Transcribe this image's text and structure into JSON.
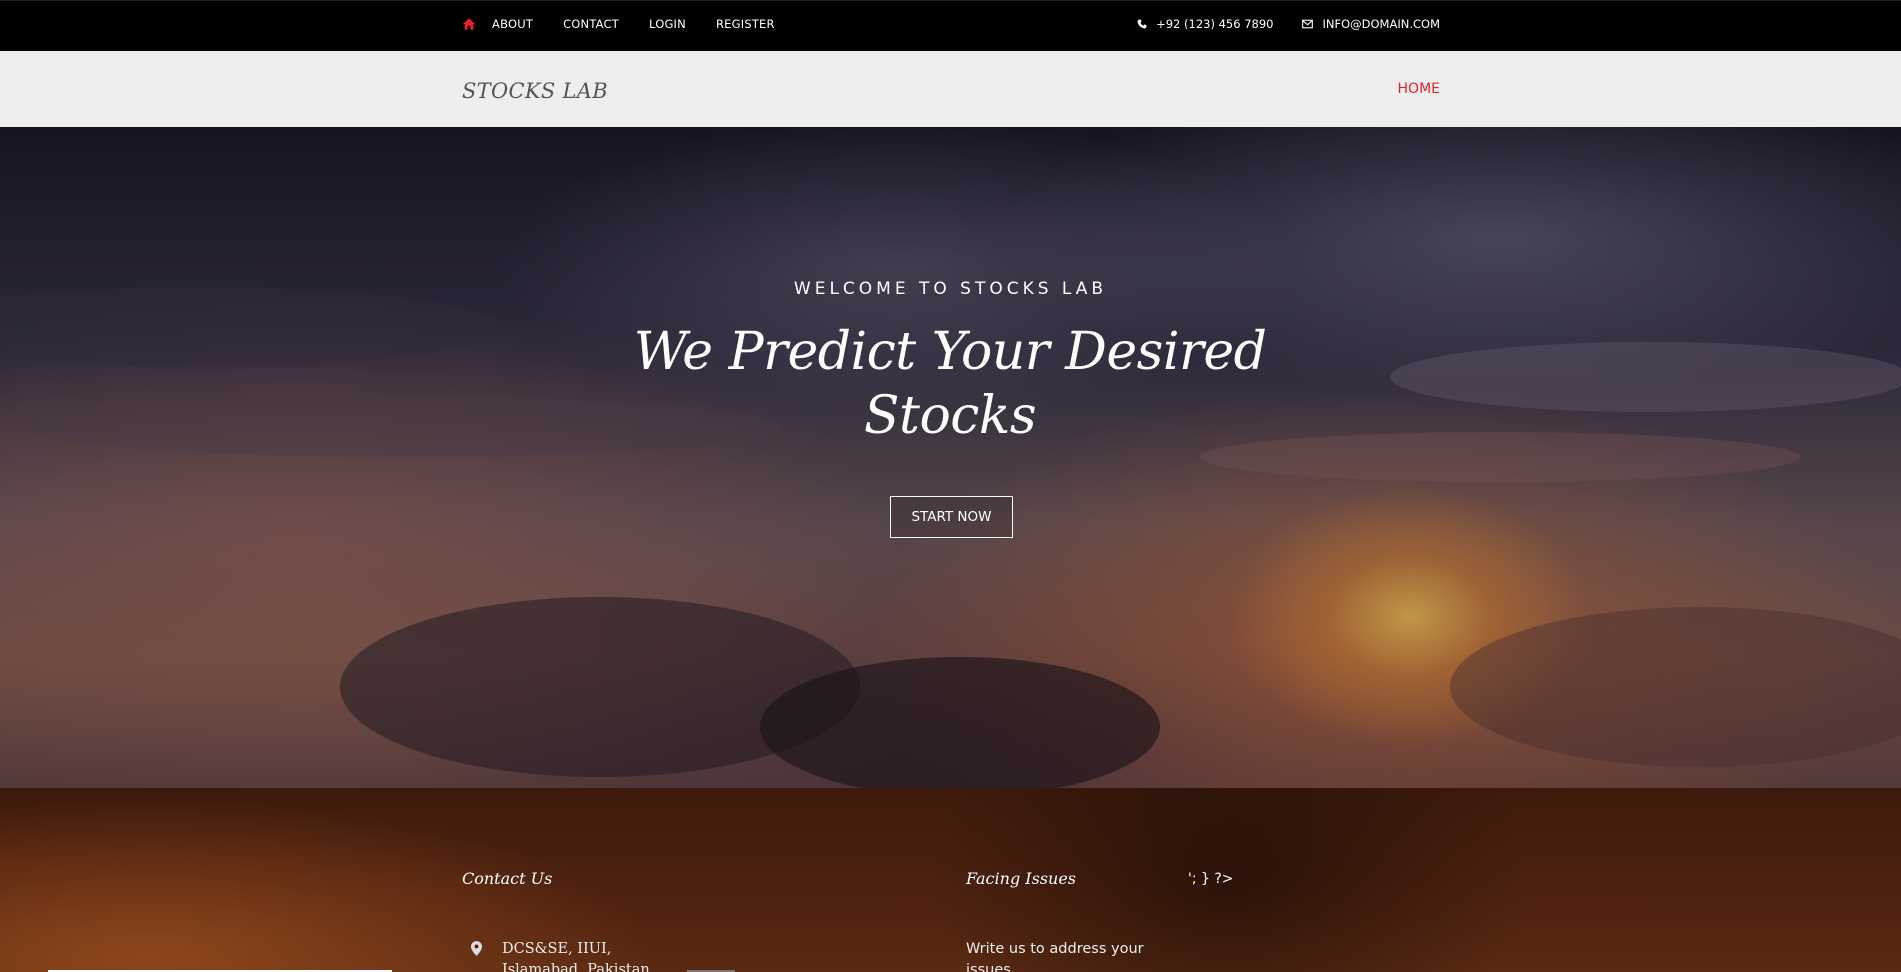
{
  "topbar": {
    "nav": [
      "ABOUT",
      "CONTACT",
      "LOGIN",
      "REGISTER"
    ],
    "phone": "+92 (123) 456 7890",
    "email": "INFO@DOMAIN.COM",
    "accent_color": "#e4222b"
  },
  "header": {
    "logo": "STOCKS LAB",
    "home_link": "HOME"
  },
  "hero": {
    "welcome": "WELCOME TO STOCKS LAB",
    "headline": "We Predict Your Desired Stocks",
    "cta": "START NOW"
  },
  "footer": {
    "contact_title": "Contact Us",
    "address": "DCS&SE, IIUI, Islamabad, Pakistan",
    "issues_title": "Facing Issues",
    "stray_text": "'; } ?>",
    "issues_text": "Write us to address your issues"
  }
}
